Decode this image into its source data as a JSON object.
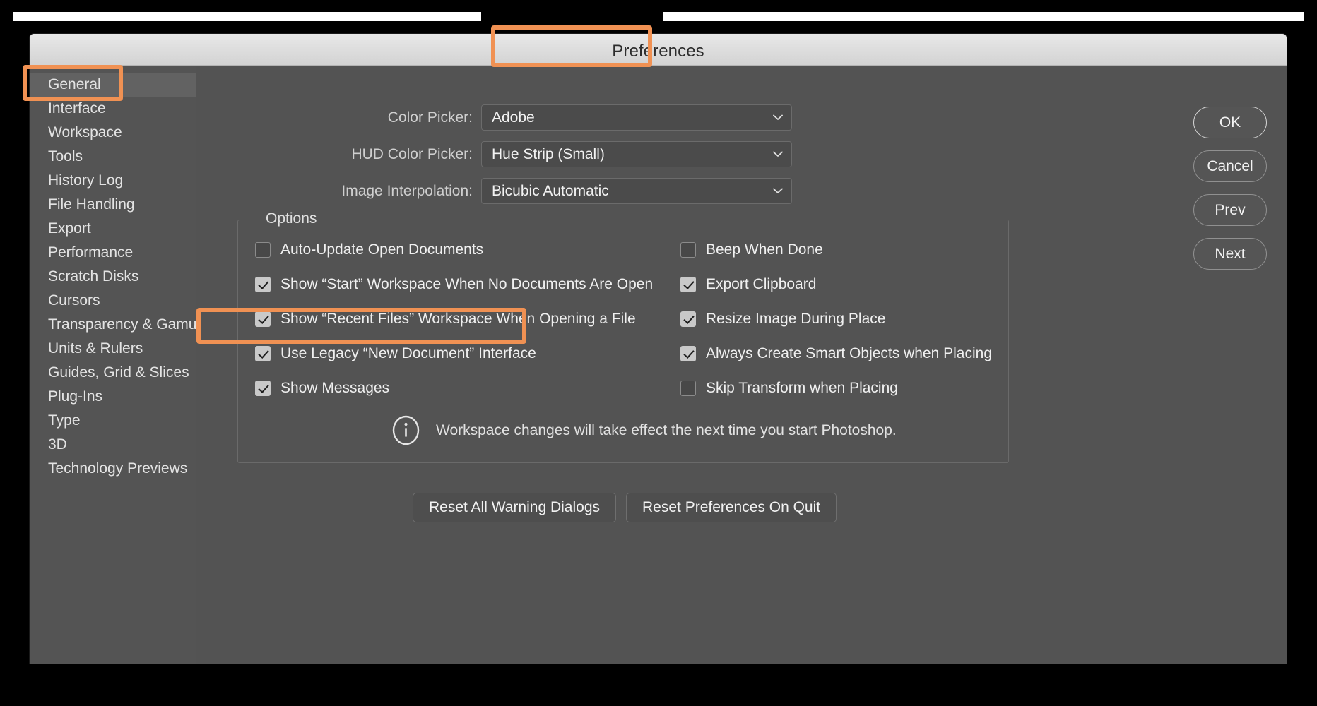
{
  "window": {
    "title": "Preferences"
  },
  "sidebar": {
    "items": [
      {
        "label": "General",
        "selected": true
      },
      {
        "label": "Interface",
        "selected": false
      },
      {
        "label": "Workspace",
        "selected": false
      },
      {
        "label": "Tools",
        "selected": false
      },
      {
        "label": "History Log",
        "selected": false
      },
      {
        "label": "File Handling",
        "selected": false
      },
      {
        "label": "Export",
        "selected": false
      },
      {
        "label": "Performance",
        "selected": false
      },
      {
        "label": "Scratch Disks",
        "selected": false
      },
      {
        "label": "Cursors",
        "selected": false
      },
      {
        "label": "Transparency & Gamut",
        "selected": false
      },
      {
        "label": "Units & Rulers",
        "selected": false
      },
      {
        "label": "Guides, Grid & Slices",
        "selected": false
      },
      {
        "label": "Plug-Ins",
        "selected": false
      },
      {
        "label": "Type",
        "selected": false
      },
      {
        "label": "3D",
        "selected": false
      },
      {
        "label": "Technology Previews",
        "selected": false
      }
    ]
  },
  "fields": [
    {
      "label": "Color Picker:",
      "value": "Adobe"
    },
    {
      "label": "HUD Color Picker:",
      "value": "Hue Strip (Small)"
    },
    {
      "label": "Image Interpolation:",
      "value": "Bicubic Automatic"
    }
  ],
  "options": {
    "title": "Options",
    "left_column": [
      {
        "label": "Auto-Update Open Documents",
        "checked": false
      },
      {
        "label": "Show “Start” Workspace When No Documents Are Open",
        "checked": true
      },
      {
        "label": "Show “Recent Files” Workspace When Opening a File",
        "checked": true
      },
      {
        "label": "Use Legacy “New Document” Interface",
        "checked": true
      },
      {
        "label": "Show Messages",
        "checked": true
      }
    ],
    "right_column": [
      {
        "label": "Beep When Done",
        "checked": false
      },
      {
        "label": "Export Clipboard",
        "checked": true
      },
      {
        "label": "Resize Image During Place",
        "checked": true
      },
      {
        "label": "Always Create Smart Objects when Placing",
        "checked": true
      },
      {
        "label": "Skip Transform when Placing",
        "checked": false
      }
    ],
    "note": "Workspace changes will take effect the next time you start Photoshop."
  },
  "reset_buttons": [
    {
      "label": "Reset All Warning Dialogs"
    },
    {
      "label": "Reset Preferences On Quit"
    }
  ],
  "side_buttons": [
    {
      "label": "OK",
      "primary": true
    },
    {
      "label": "Cancel",
      "primary": false
    },
    {
      "label": "Prev",
      "primary": false
    },
    {
      "label": "Next",
      "primary": false
    }
  ],
  "annotations": {
    "color": "#f09153",
    "targets": [
      "Preferences",
      "General",
      "Use Legacy “New Document” Interface"
    ]
  }
}
